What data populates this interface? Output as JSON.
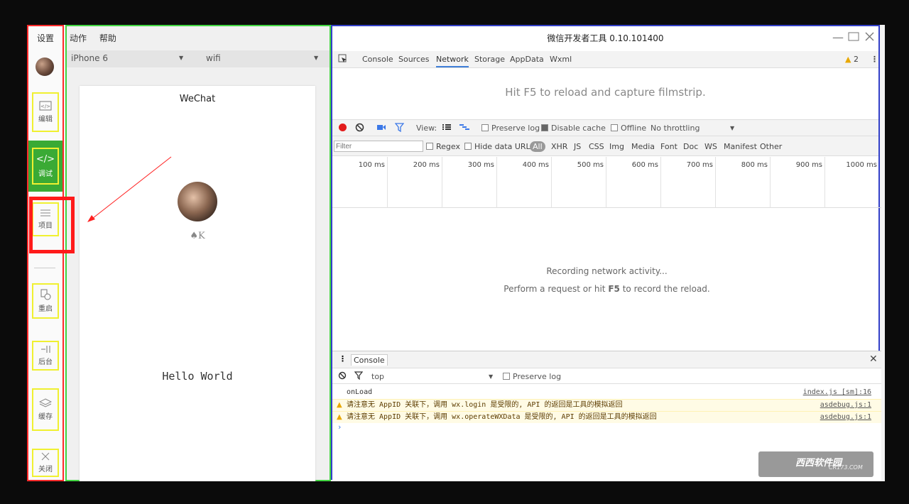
{
  "sidebar": {
    "settings_label": "设置",
    "buttons": [
      {
        "label": "编辑",
        "icon": "code-box-icon"
      },
      {
        "label": "调试",
        "icon": "code-icon"
      },
      {
        "label": "项目",
        "icon": "menu-lines-icon"
      },
      {
        "label": "重启",
        "icon": "restart-icon"
      },
      {
        "label": "后台",
        "icon": "background-icon"
      },
      {
        "label": "缓存",
        "icon": "layers-icon"
      },
      {
        "label": "关闭",
        "icon": "close-icon"
      }
    ]
  },
  "simulator": {
    "menu": [
      "动作",
      "帮助"
    ],
    "device": "iPhone 6",
    "network": "wifi",
    "phone_title": "WeChat",
    "user_name": "♠K",
    "hello": "Hello World"
  },
  "devtools": {
    "title": "微信开发者工具 0.10.101400",
    "tabs": [
      "Console",
      "Sources",
      "Network",
      "Storage",
      "AppData",
      "Wxml"
    ],
    "active_tab": "Network",
    "warning_count": "2",
    "filmstrip_hint": "Hit F5 to reload and capture filmstrip.",
    "controls": {
      "view_label": "View:",
      "preserve_log": "Preserve log",
      "disable_cache": "Disable cache",
      "offline": "Offline",
      "throttling": "No throttling"
    },
    "filter": {
      "placeholder": "Filter",
      "regex": "Regex",
      "hide_data_urls": "Hide data URLs",
      "types": [
        "All",
        "XHR",
        "JS",
        "CSS",
        "Img",
        "Media",
        "Font",
        "Doc",
        "WS",
        "Manifest",
        "Other"
      ]
    },
    "timeline_ticks": [
      "100 ms",
      "200 ms",
      "300 ms",
      "400 ms",
      "500 ms",
      "600 ms",
      "700 ms",
      "800 ms",
      "900 ms",
      "1000 ms"
    ],
    "recording_text": "Recording network activity...",
    "perform_pre": "Perform a request or hit ",
    "perform_key": "F5",
    "perform_post": " to record the reload.",
    "console": {
      "tab_label": "Console",
      "context": "top",
      "preserve_log": "Preserve log",
      "logs": [
        {
          "text": "onLoad",
          "source": "index.js [sm]:16",
          "level": "info"
        },
        {
          "text": "请注意无 AppID 关联下，调用 wx.login 是受限的, API 的返回是工具的模拟返回",
          "source": "asdebug.js:1",
          "level": "warn"
        },
        {
          "text": "请注意无 AppID 关联下，调用 wx.operateWXData 是受限的, API 的返回是工具的模拟返回",
          "source": "asdebug.js:1",
          "level": "warn"
        }
      ]
    }
  },
  "watermark": {
    "main": "西西软件园",
    "sub": "CR173.COM"
  },
  "colors": {
    "debug_active": "#3aaa35",
    "highlight_yellow": "#f0f030",
    "annotation_red": "#ff1a1a",
    "sim_border": "#41d541",
    "dev_border": "#3340c8"
  }
}
